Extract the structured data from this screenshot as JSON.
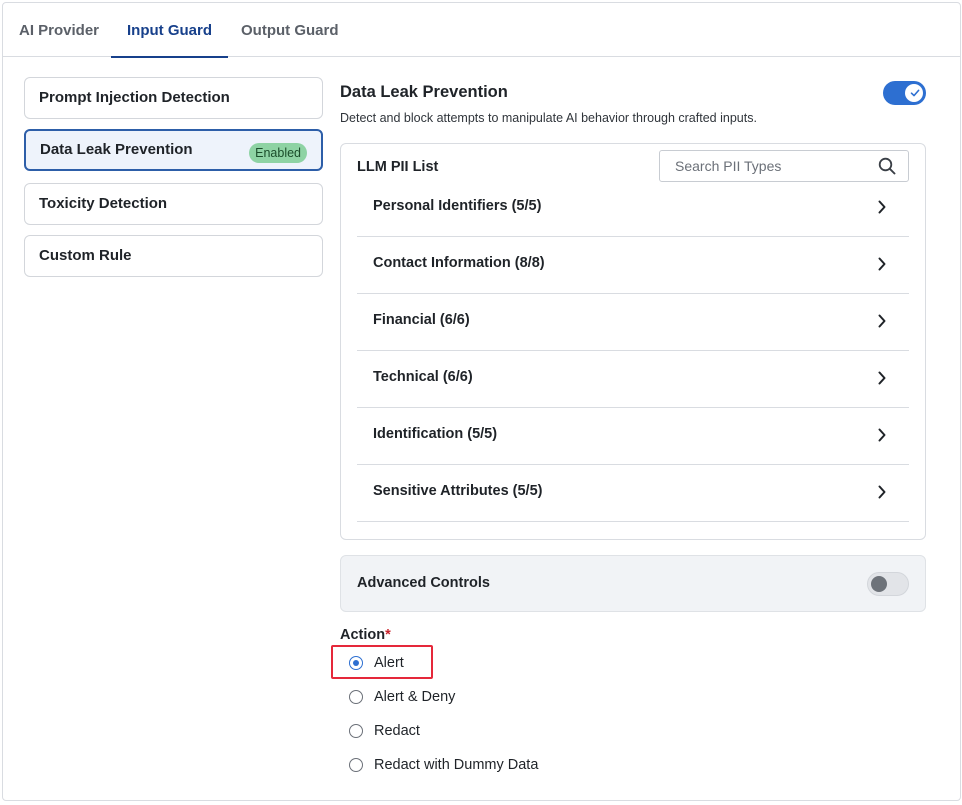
{
  "tabs": [
    {
      "label": "AI Provider",
      "active": false
    },
    {
      "label": "Input Guard",
      "active": true
    },
    {
      "label": "Output Guard",
      "active": false
    }
  ],
  "menu": {
    "items": [
      {
        "label": "Prompt Injection Detection"
      },
      {
        "label": "Data Leak Prevention",
        "badge": "Enabled",
        "active": true
      },
      {
        "label": "Toxicity Detection"
      },
      {
        "label": "Custom Rule"
      }
    ]
  },
  "panel": {
    "title": "Data Leak Prevention",
    "description": "Detect and block attempts to manipulate AI behavior through crafted inputs.",
    "enabled": true,
    "accent_color": "#2d6fd1"
  },
  "pii": {
    "title": "LLM PII List",
    "search_placeholder": "Search PII Types",
    "search_icon": "search-icon",
    "row_icon": "chevron-right-icon",
    "categories": [
      {
        "label": "Personal Identifiers (5/5)"
      },
      {
        "label": "Contact Information (8/8)"
      },
      {
        "label": "Financial (6/6)"
      },
      {
        "label": "Technical (6/6)"
      },
      {
        "label": "Identification (5/5)"
      },
      {
        "label": "Sensitive Attributes (5/5)"
      }
    ]
  },
  "advanced": {
    "label": "Advanced Controls",
    "enabled": false
  },
  "action": {
    "label": "Action",
    "required_mark": "*",
    "selected": "Alert",
    "options": [
      {
        "label": "Alert",
        "checked": true
      },
      {
        "label": "Alert & Deny",
        "checked": false
      },
      {
        "label": "Redact",
        "checked": false
      },
      {
        "label": "Redact with Dummy Data",
        "checked": false
      }
    ],
    "highlight_color": "#e5283a"
  }
}
